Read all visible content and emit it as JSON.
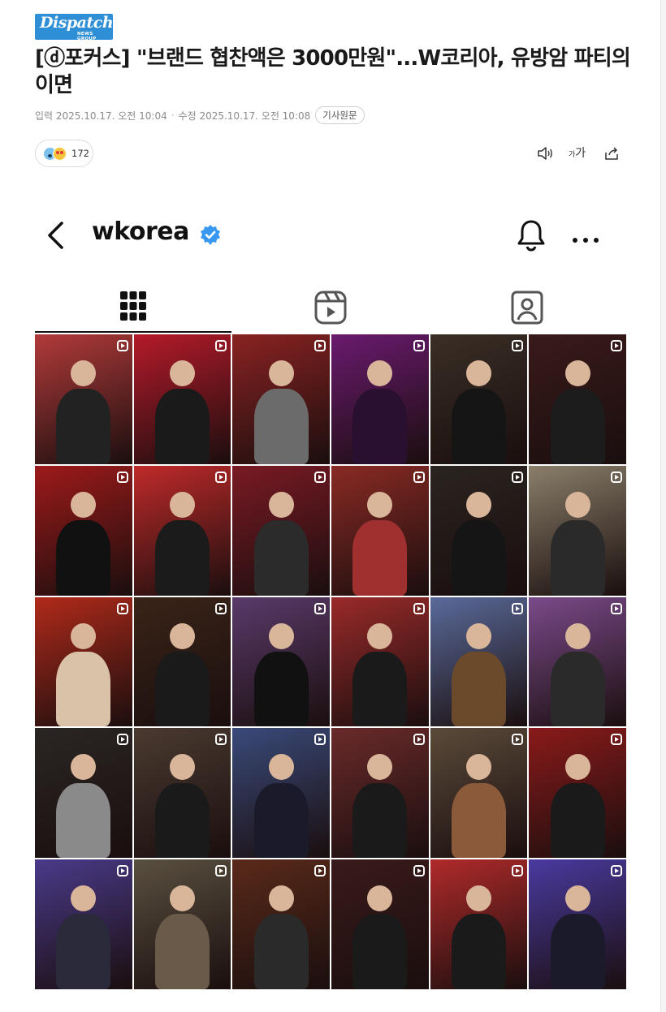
{
  "brand": {
    "logo_text": "Dispatch",
    "logo_sub": "NEWS GROUP"
  },
  "article": {
    "title": "[ⓓ포커스] \"브랜드 협찬액은 3000만원\"...W코리아, 유방암 파티의 이면",
    "published": "입력 2025.10.17. 오전 10:04",
    "separator": "·",
    "modified": "수정 2025.10.17. 오전 10:08",
    "original_button": "기사원문",
    "reaction_count": "172"
  },
  "tools": {
    "font_small": "가",
    "font_large": "가"
  },
  "instagram": {
    "username": "wkorea",
    "tabs": [
      "grid-icon",
      "reels-icon",
      "tagged-icon"
    ],
    "tiles": [
      {
        "bg": "#b23a3a",
        "fig": "#222"
      },
      {
        "bg": "#b51a2a",
        "fig": "#1a1a1a"
      },
      {
        "bg": "#8a2222",
        "fig": "#6b6b6b"
      },
      {
        "bg": "#6a1a6e",
        "fig": "#2a1030"
      },
      {
        "bg": "#3a2e26",
        "fig": "#151515"
      },
      {
        "bg": "#3a1a1a",
        "fig": "#1c1c1c"
      },
      {
        "bg": "#9e1a1a",
        "fig": "#111"
      },
      {
        "bg": "#c02a2a",
        "fig": "#1b1b1b"
      },
      {
        "bg": "#7a1a24",
        "fig": "#2b2b2b"
      },
      {
        "bg": "#8a2a24",
        "fig": "#a03030"
      },
      {
        "bg": "#2a2420",
        "fig": "#151515"
      },
      {
        "bg": "#8a7e6a",
        "fig": "#2a2a2a"
      },
      {
        "bg": "#b02a1a",
        "fig": "#d9c2a8"
      },
      {
        "bg": "#3a2418",
        "fig": "#1a1a1a"
      },
      {
        "bg": "#5a3a6a",
        "fig": "#111"
      },
      {
        "bg": "#9a2a2a",
        "fig": "#1a1a1a"
      },
      {
        "bg": "#5a6a9a",
        "fig": "#6a4a2a"
      },
      {
        "bg": "#7a4a8a",
        "fig": "#2a2a2a"
      },
      {
        "bg": "#2a2624",
        "fig": "#8a8a8a"
      },
      {
        "bg": "#4a3a30",
        "fig": "#1a1a1a"
      },
      {
        "bg": "#3a4a7a",
        "fig": "#1a1a2a"
      },
      {
        "bg": "#6a2a2a",
        "fig": "#1a1a1a"
      },
      {
        "bg": "#5a4a3a",
        "fig": "#8a5a3a"
      },
      {
        "bg": "#8a1a1a",
        "fig": "#1a1a1a"
      },
      {
        "bg": "#4a3a8a",
        "fig": "#2a2a3a"
      },
      {
        "bg": "#5a5040",
        "fig": "#6a5a4a"
      },
      {
        "bg": "#5a2a1a",
        "fig": "#2a2a2a"
      },
      {
        "bg": "#3a1a1a",
        "fig": "#1a1a1a"
      },
      {
        "bg": "#b02a2a",
        "fig": "#1a1a1a"
      },
      {
        "bg": "#4a3aa0",
        "fig": "#1a1a2a"
      }
    ]
  },
  "colors": {
    "logo_bg": "#2f8fd6",
    "verified": "#3897f0"
  }
}
